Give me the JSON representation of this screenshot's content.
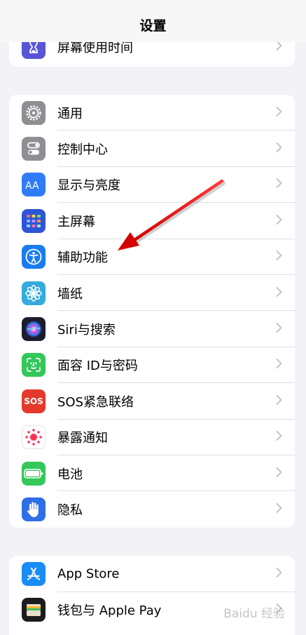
{
  "nav": {
    "title": "设置"
  },
  "top_group": {
    "label": "屏幕使用时间"
  },
  "main_group": [
    {
      "key": "general",
      "label": "通用",
      "icon": "gear-icon",
      "color": "#8e8e93"
    },
    {
      "key": "control-center",
      "label": "控制中心",
      "icon": "toggle-icon",
      "color": "#8e8e93"
    },
    {
      "key": "display",
      "label": "显示与亮度",
      "icon": "text-size-icon",
      "color": "#2f7cf6"
    },
    {
      "key": "home-screen",
      "label": "主屏幕",
      "icon": "app-grid-icon",
      "color": "#2e55d6"
    },
    {
      "key": "accessibility",
      "label": "辅助功能",
      "icon": "accessibility-icon",
      "color": "#1a7cf0"
    },
    {
      "key": "wallpaper",
      "label": "墙纸",
      "icon": "flower-icon",
      "color": "#36aadc"
    },
    {
      "key": "siri",
      "label": "Siri与搜索",
      "icon": "siri-icon",
      "color": "#1c1c2e"
    },
    {
      "key": "faceid",
      "label": "面容 ID与密码",
      "icon": "faceid-icon",
      "color": "#34c759"
    },
    {
      "key": "sos",
      "label": "SOS紧急联络",
      "icon": "sos-icon",
      "color": "#e5392c",
      "icon_text": "SOS"
    },
    {
      "key": "exposure",
      "label": "暴露通知",
      "icon": "exposure-icon",
      "color": "#ffffff"
    },
    {
      "key": "battery",
      "label": "电池",
      "icon": "battery-icon",
      "color": "#34c759"
    },
    {
      "key": "privacy",
      "label": "隐私",
      "icon": "hand-icon",
      "color": "#2f6ee6"
    }
  ],
  "store_group": [
    {
      "key": "app-store",
      "label": "App Store",
      "icon": "app-store-icon",
      "color": "#1a8cf5"
    },
    {
      "key": "wallet",
      "label": "钱包与 Apple Pay",
      "icon": "wallet-icon",
      "color": "#1c1c1e"
    }
  ],
  "watermark": "Baidu 经验"
}
